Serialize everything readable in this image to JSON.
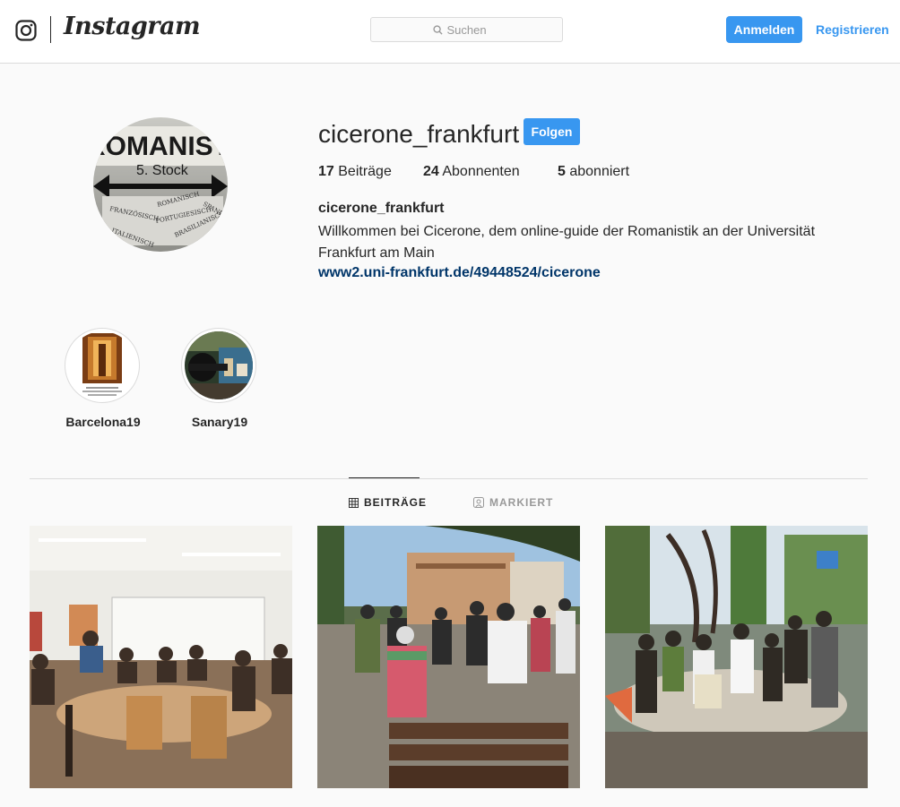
{
  "header": {
    "brand": "Instagram",
    "search_placeholder": "Suchen",
    "login_label": "Anmelden",
    "register_label": "Registrieren"
  },
  "profile": {
    "username": "cicerone_frankfurt",
    "follow_label": "Folgen",
    "stats": [
      {
        "count": "17",
        "label": "Beiträge"
      },
      {
        "count": "24",
        "label": "Abonnenten"
      },
      {
        "count": "5",
        "label": "abonniert"
      }
    ],
    "full_name": "cicerone_frankfurt",
    "bio": "Willkommen bei Cicerone, dem online-guide der Romanistik an der Universität Frankfurt am Main",
    "website": "www2.uni-frankfurt.de/49448524/cicerone",
    "avatar_sign": {
      "line1": "ROMANISTI",
      "line2": "5. Stock",
      "words": [
        "FRANZÖSISCH",
        "ROMANISCH",
        "SPANISCH",
        "PORTUGIESISCH",
        "BRASILIANISCH",
        "ITALIENISCH"
      ]
    }
  },
  "highlights": [
    {
      "label": "Barcelona19"
    },
    {
      "label": "Sanary19"
    }
  ],
  "tabs": [
    {
      "label": "BEITRÄGE",
      "active": true
    },
    {
      "label": "MARKIERT",
      "active": false
    }
  ],
  "colors": {
    "accent": "#3897f0",
    "link": "#003569",
    "border": "#dbdbdb",
    "muted": "#999999"
  }
}
